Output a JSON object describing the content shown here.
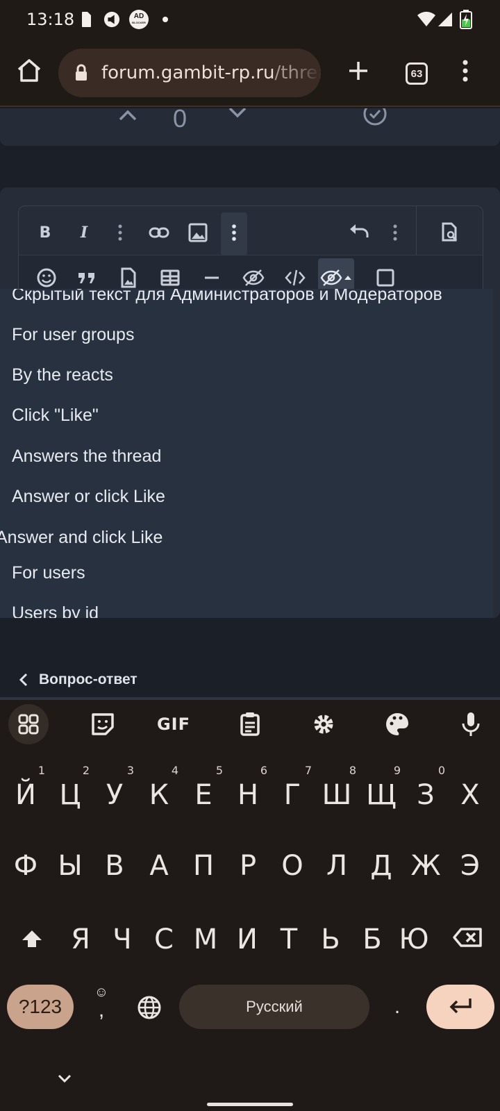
{
  "status_bar": {
    "time": "13:18",
    "adblock_label": "AD",
    "adblock_sub": "BLOCKER"
  },
  "browser": {
    "url_domain": "forum.gambit-rp.ru",
    "url_path": "/threa",
    "tabs_count": "63"
  },
  "vote_bar": {
    "count": "0"
  },
  "editor": {
    "toolbar": {
      "bold_label": "B",
      "italic_label": "I"
    },
    "hide_menu_items": [
      "Скрытый текст для Администраторов и Модераторов",
      "For user groups",
      "By the reacts",
      "Click \"Like\"",
      "Answers the thread",
      "Answer or click Like",
      "Answer and click Like",
      "For users",
      "Users by id"
    ]
  },
  "breadcrumb": {
    "back_label": "Вопрос-ответ"
  },
  "keyboard": {
    "gif_label": "GIF",
    "row1": [
      "Й",
      "Ц",
      "У",
      "К",
      "Е",
      "Н",
      "Г",
      "Ш",
      "Щ",
      "З",
      "Х"
    ],
    "row1_hints": [
      "1",
      "2",
      "3",
      "4",
      "5",
      "6",
      "7",
      "8",
      "9",
      "0",
      ""
    ],
    "row2": [
      "Ф",
      "Ы",
      "В",
      "А",
      "П",
      "Р",
      "О",
      "Л",
      "Д",
      "Ж",
      "Э"
    ],
    "row3": [
      "Я",
      "Ч",
      "С",
      "М",
      "И",
      "Т",
      "Ь",
      "Б",
      "Ю"
    ],
    "symbols_label": "?123",
    "comma_label": ",",
    "space_label": "Русский",
    "period_label": "."
  }
}
